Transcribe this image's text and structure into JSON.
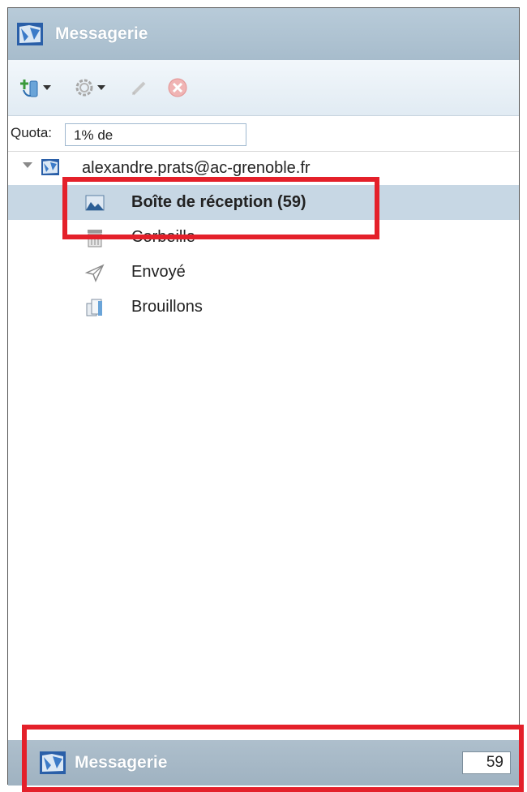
{
  "window": {
    "title": "Messagerie"
  },
  "toolbar": {
    "icons": [
      "new-folder-icon",
      "gear-icon",
      "pencil-icon",
      "delete-icon"
    ]
  },
  "quota": {
    "label": "Quota:",
    "value": "1% de"
  },
  "account": {
    "email": "alexandre.prats@ac-grenoble.fr"
  },
  "folders": [
    {
      "label": "Boîte de réception (59)",
      "icon": "inbox-icon",
      "selected": true
    },
    {
      "label": "Corbeille",
      "icon": "trash-icon",
      "selected": false
    },
    {
      "label": "Envoyé",
      "icon": "sent-icon",
      "selected": false
    },
    {
      "label": "Brouillons",
      "icon": "drafts-icon",
      "selected": false
    }
  ],
  "bottombar": {
    "title": "Messagerie",
    "count": "59"
  },
  "colors": {
    "highlight": "#e4202a",
    "selection": "#c7d7e4",
    "title_bar": "#b8cbd9"
  }
}
